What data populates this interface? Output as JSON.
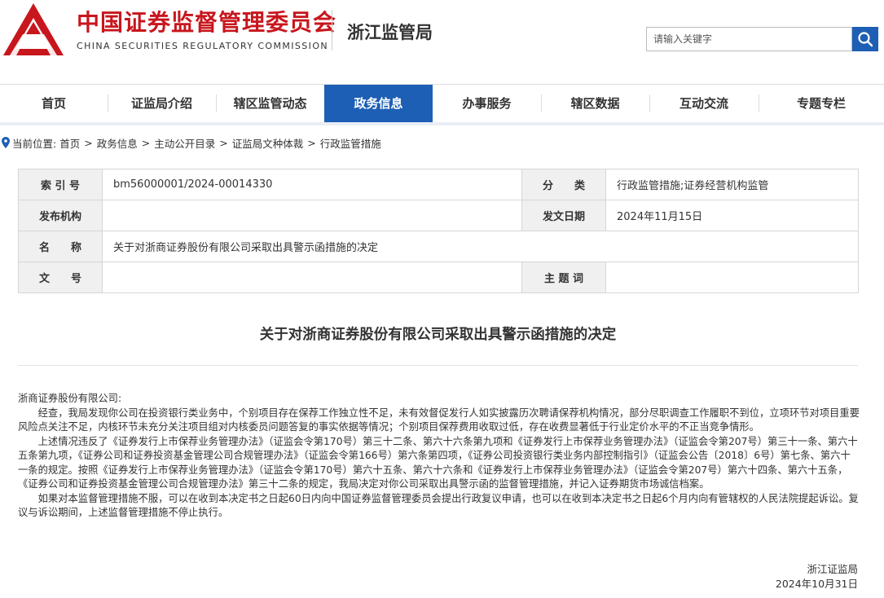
{
  "header": {
    "title_cn": "中国证券监督管理委员会",
    "title_en": "CHINA SECURITIES REGULATORY COMMISSION",
    "bureau": "浙江监管局",
    "search_placeholder": "请输入关键字",
    "logo_color": "#c8161d"
  },
  "nav": {
    "active_index": 3,
    "accent": "#1d5fb4",
    "items": [
      "首页",
      "证监局介绍",
      "辖区监管动态",
      "政务信息",
      "办事服务",
      "辖区数据",
      "互动交流",
      "专题专栏"
    ]
  },
  "breadcrumb": {
    "prefix": "当前位置:",
    "items": [
      "首页",
      "政务信息",
      "主动公开目录",
      "证监局文种体裁",
      "行政监管措施"
    ],
    "separator": ">"
  },
  "info": {
    "index_label": "索 引 号",
    "index_value": "bm56000001/2024-00014330",
    "category_label": "分　　类",
    "category_value": "行政监管措施;证券经营机构监管",
    "publisher_label": "发布机构",
    "publisher_value": "",
    "date_label": "发文日期",
    "date_value": "2024年11月15日",
    "name_label": "名　　称",
    "name_value": "关于对浙商证券股份有限公司采取出具警示函措施的决定",
    "docno_label": "文　　号",
    "docno_value": "",
    "subject_label": "主 题 词",
    "subject_value": ""
  },
  "article": {
    "title": "关于对浙商证券股份有限公司采取出具警示函措施的决定",
    "addressee": "浙商证券股份有限公司:",
    "paragraphs": [
      "经查，我局发现你公司在投资银行类业务中，个别项目存在保荐工作独立性不足，未有效督促发行人如实披露历次聘请保荐机构情况，部分尽职调查工作履职不到位，立项环节对项目重要风险点关注不足，内核环节未充分关注项目组对内核委员问题答复的事实依据等情况；个别项目保荐费用收取过低，存在收费显著低于行业定价水平的不正当竞争情形。",
      "上述情况违反了《证券发行上市保荐业务管理办法》（证监会令第170号）第三十二条、第六十六条第九项和《证券发行上市保荐业务管理办法》（证监会令第207号）第三十一条、第六十五条第九项，《证券公司和证券投资基金管理公司合规管理办法》（证监会令第166号）第六条第四项，《证券公司投资银行类业务内部控制指引》（证监会公告〔2018〕6号）第七条、第六十一条的规定。按照《证券发行上市保荐业务管理办法》（证监会令第170号）第六十五条、第六十六条和《证券发行上市保荐业务管理办法》（证监会令第207号）第六十四条、第六十五条，《证券公司和证券投资基金管理公司合规管理办法》第三十二条的规定，我局决定对你公司采取出具警示函的监督管理措施，并记入证券期货市场诚信档案。",
      "如果对本监督管理措施不服，可以在收到本决定书之日起60日内向中国证券监督管理委员会提出行政复议申请，也可以在收到本决定书之日起6个月内向有管辖权的人民法院提起诉讼。复议与诉讼期间，上述监督管理措施不停止执行。"
    ],
    "signer": "浙江证监局",
    "sign_date": "2024年10月31日"
  }
}
